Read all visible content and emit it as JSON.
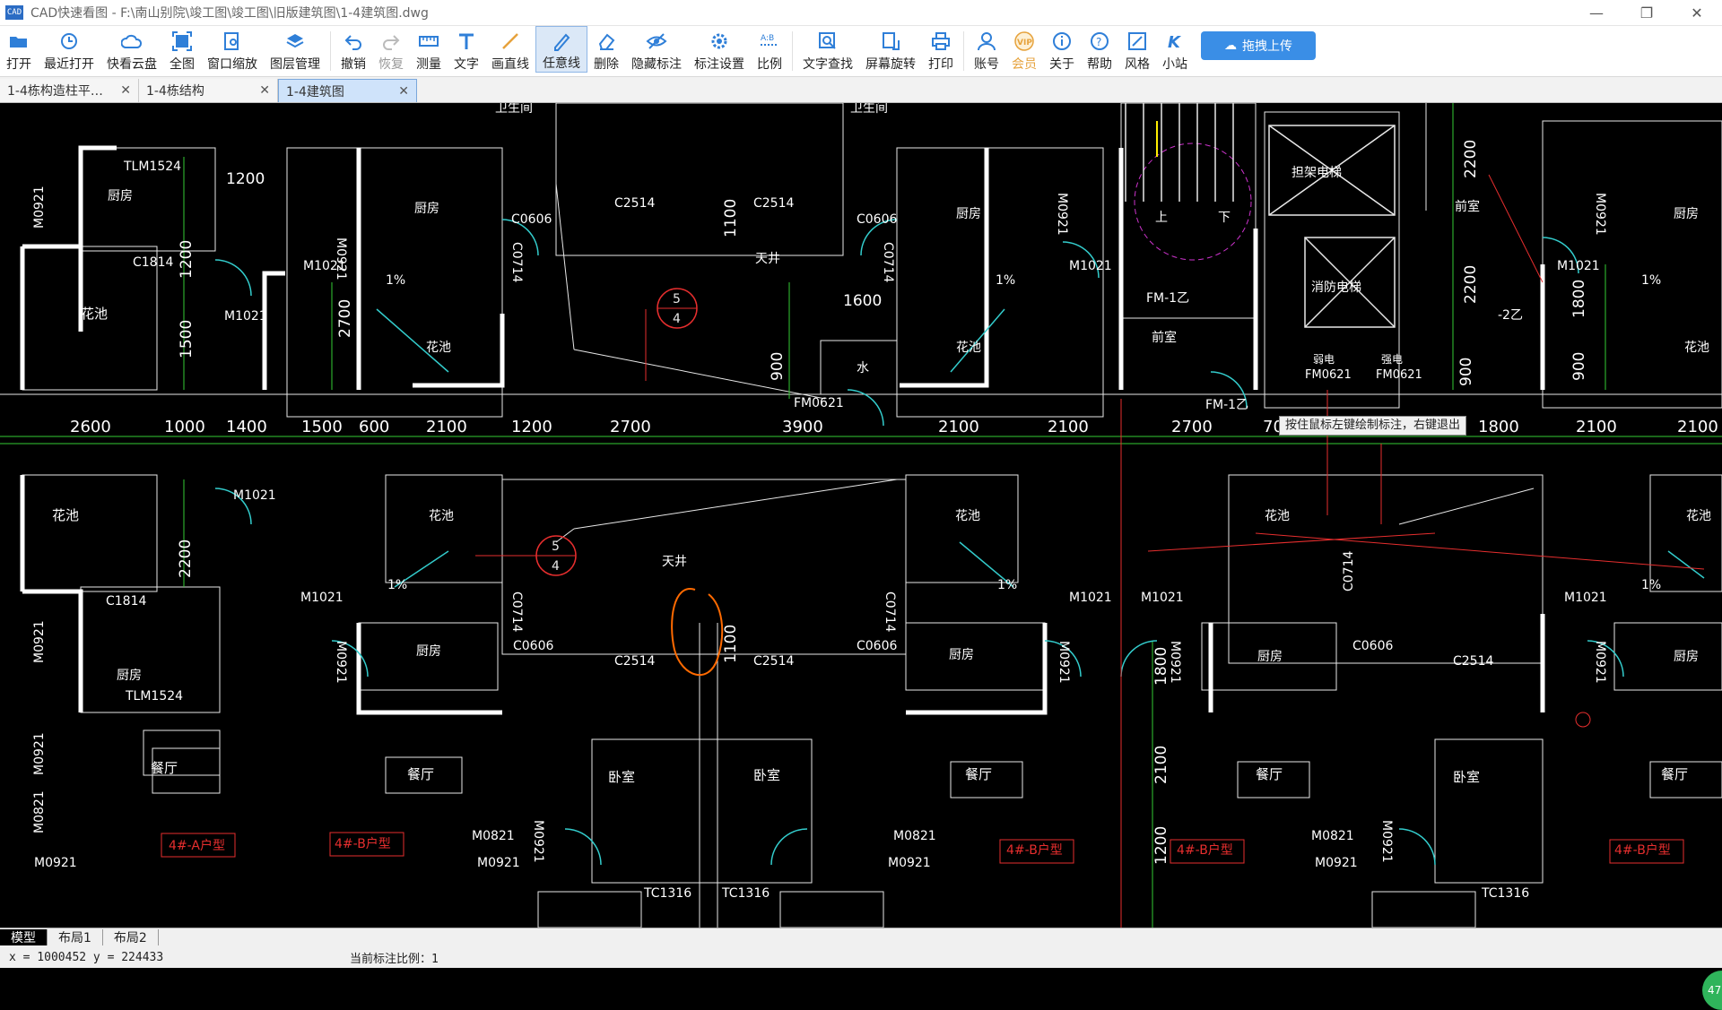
{
  "window": {
    "logo_text": "CAD",
    "title": "CAD快速看图 - F:\\南山别院\\竣工图\\竣工图\\旧版建筑图\\1-4建筑图.dwg",
    "controls": [
      "—",
      "❐",
      "✕"
    ]
  },
  "toolbar": {
    "items": [
      {
        "label": "打开",
        "icon": "folder-open-icon"
      },
      {
        "label": "最近打开",
        "icon": "history-icon"
      },
      {
        "label": "快看云盘",
        "icon": "cloud-icon"
      },
      {
        "label": "全图",
        "icon": "fit-all-icon"
      },
      {
        "label": "窗口缩放",
        "icon": "window-zoom-icon"
      },
      {
        "label": "图层管理",
        "icon": "layers-icon"
      },
      {
        "label": "撤销",
        "icon": "undo-icon"
      },
      {
        "label": "恢复",
        "icon": "redo-icon"
      },
      {
        "label": "测量",
        "icon": "measure-icon"
      },
      {
        "label": "文字",
        "icon": "text-icon"
      },
      {
        "label": "画直线",
        "icon": "line-icon"
      },
      {
        "label": "任意线",
        "icon": "freehand-icon"
      },
      {
        "label": "删除",
        "icon": "eraser-icon"
      },
      {
        "label": "隐藏标注",
        "icon": "eye-hide-icon"
      },
      {
        "label": "标注设置",
        "icon": "annotation-settings-icon"
      },
      {
        "label": "比例",
        "icon": "scale-icon"
      },
      {
        "label": "文字查找",
        "icon": "text-search-icon"
      },
      {
        "label": "屏幕旋转",
        "icon": "rotate-icon"
      },
      {
        "label": "打印",
        "icon": "printer-icon"
      },
      {
        "label": "账号",
        "icon": "user-icon"
      },
      {
        "label": "会员",
        "icon": "vip-icon"
      },
      {
        "label": "关于",
        "icon": "info-icon"
      },
      {
        "label": "帮助",
        "icon": "help-icon"
      },
      {
        "label": "风格",
        "icon": "style-icon"
      },
      {
        "label": "小站",
        "icon": "k-site-icon"
      }
    ],
    "active_item": "任意线",
    "upload_label": "拖拽上传",
    "accent_color": "#3a8ee6",
    "vip_color": "#e6a23c"
  },
  "tabs": [
    {
      "label": "1-4栋构造柱平…",
      "active": false
    },
    {
      "label": "1-4栋结构",
      "active": false
    },
    {
      "label": "1-4建筑图",
      "active": true
    }
  ],
  "drawing": {
    "top_labels": {
      "tlm1524_a": "TLM1524",
      "kitchen_a": "厨房",
      "dim_1200_a": "1200",
      "c1814_a": "C1814",
      "m1021_a": "M1021",
      "garden_a": "花池",
      "dim_1200_b": "1200",
      "dim_1500": "1500",
      "m0921_a": "M0921",
      "wc_a": "卫生间",
      "wc_b": "卫生间",
      "m0921_b": "M0921",
      "kitchen_b": "厨房",
      "m1021_b": "M1021",
      "dim_2700": "2700",
      "pct_a": "1%",
      "garden_b": "花池",
      "c0606_a": "C0606",
      "c0714_a": "C0714",
      "c2514_a": "C2514",
      "dim_1100_a": "1100",
      "c2514_b": "C2514",
      "c0606_b": "C0606",
      "c0714_b": "C0714",
      "courtyard_a": "天井",
      "bubble_top": "5",
      "bubble_bottom": "4",
      "dim_1600_a": "1600",
      "dim_900_a": "900",
      "water": "水",
      "fm0621_a": "FM0621",
      "kitchen_c": "厨房",
      "pct_b": "1%",
      "garden_c": "花池",
      "m0921_c": "M0921",
      "m1021_c": "M1021",
      "up": "上",
      "down": "下",
      "fm1z_a": "FM-1乙",
      "lobby": "前室",
      "elevator": "担架电梯",
      "fire_elevator": "消防电梯",
      "front_room": "前室",
      "dim_2200_a": "2200",
      "dim_2200_b": "2200",
      "weak": "弱电",
      "strong": "强电",
      "fm0621_b": "FM0621",
      "fm0621_c": "FM0621",
      "dim_900_b": "900",
      "fm1z_b": "FM-1乙",
      "m0921_d": "M0921",
      "kitchen_d": "厨房",
      "m1021_d": "M1021",
      "pct_c": "1%",
      "dim_1800_a": "1800",
      "dim_900_c": "900",
      "garden_d": "花池",
      "tip_2z": "-2乙"
    },
    "dimension_row": [
      "2600",
      "1000",
      "1400",
      "1500",
      "600",
      "2100",
      "1200",
      "2700",
      "3900",
      "2100",
      "2100",
      "2700",
      "700",
      "1300",
      "1600",
      "1800",
      "2100",
      "2100"
    ],
    "bottom_labels": {
      "garden_e": "花池",
      "m1021_e": "M1021",
      "dim_2200_c": "2200",
      "c1814_b": "C1814",
      "m0921_e": "M0921",
      "kitchen_e": "厨房",
      "tlm1524_b": "TLM1524",
      "dining_a": "餐厅",
      "m0921_f": "M0921",
      "m0821_a": "M0821",
      "m0921_g": "M0921",
      "type_a": "4#-A户型",
      "garden_f": "花池",
      "pct_d": "1%",
      "m1021_f": "M1021",
      "m0921_h": "M0921",
      "kitchen_f": "厨房",
      "c0714_c": "C0714",
      "c0606_c": "C0606",
      "bubble_top": "5",
      "bubble_bottom": "4",
      "courtyard_b": "天井",
      "c2514_c": "C2514",
      "dim_1100_b": "1100",
      "c2514_d": "C2514",
      "type_b1": "4#-B户型",
      "dining_b": "餐厅",
      "m0821_b": "M0821",
      "m0921_i": "M0921",
      "m0921_j": "M0921",
      "bedroom_a": "卧室",
      "bedroom_b": "卧室",
      "tc1316_a": "TC1316",
      "tc1316_b": "TC1316",
      "garden_g": "花池",
      "pct_e": "1%",
      "c0714_d": "C0714",
      "c0606_d": "C0606",
      "kitchen_g": "厨房",
      "m1021_g": "M1021",
      "m0921_k": "M0921",
      "m0821_c": "M0821",
      "m0921_l": "M0921",
      "dining_c": "餐厅",
      "type_b2": "4#-B户型",
      "m1021_h": "M1021",
      "dim_1800_b": "1800",
      "m0921_m": "M0921",
      "dim_2100": "2100",
      "dim_1200_c": "1200",
      "type_b3": "4#-B户型",
      "garden_h": "花池",
      "kitchen_h": "厨房",
      "c0606_e": "C0606",
      "c0714_e": "C0714",
      "c2514_e": "C2514",
      "bedroom_c": "卧室",
      "m0821_d": "M0821",
      "m0921_n": "M0921",
      "m0921_o": "M0921",
      "dining_d": "餐厅",
      "tc1316_c": "TC1316",
      "m1021_i": "M1021",
      "pct_f": "1%",
      "garden_i": "花池",
      "m0921_p": "M0921",
      "kitchen_i": "厨房",
      "dining_e": "餐厅",
      "type_b4": "4#-B户型"
    },
    "tooltip": "按住鼠标左键绘制标注，右键退出",
    "colors": {
      "wall": "#ffffff",
      "line": "#e8e8e8",
      "dim": "#33cc33",
      "cyan": "#33cccc",
      "red": "#e62e2e",
      "orange": "#ff6a00",
      "magenta": "#cc33cc",
      "yellow": "#ffee00",
      "grey": "#aaaaaa"
    }
  },
  "layout_tabs": [
    "模型",
    "布局1",
    "布局2"
  ],
  "status": {
    "coords": "x = 1000452  y = 224433",
    "scale": "当前标注比例：1"
  },
  "side_bubble": "47"
}
